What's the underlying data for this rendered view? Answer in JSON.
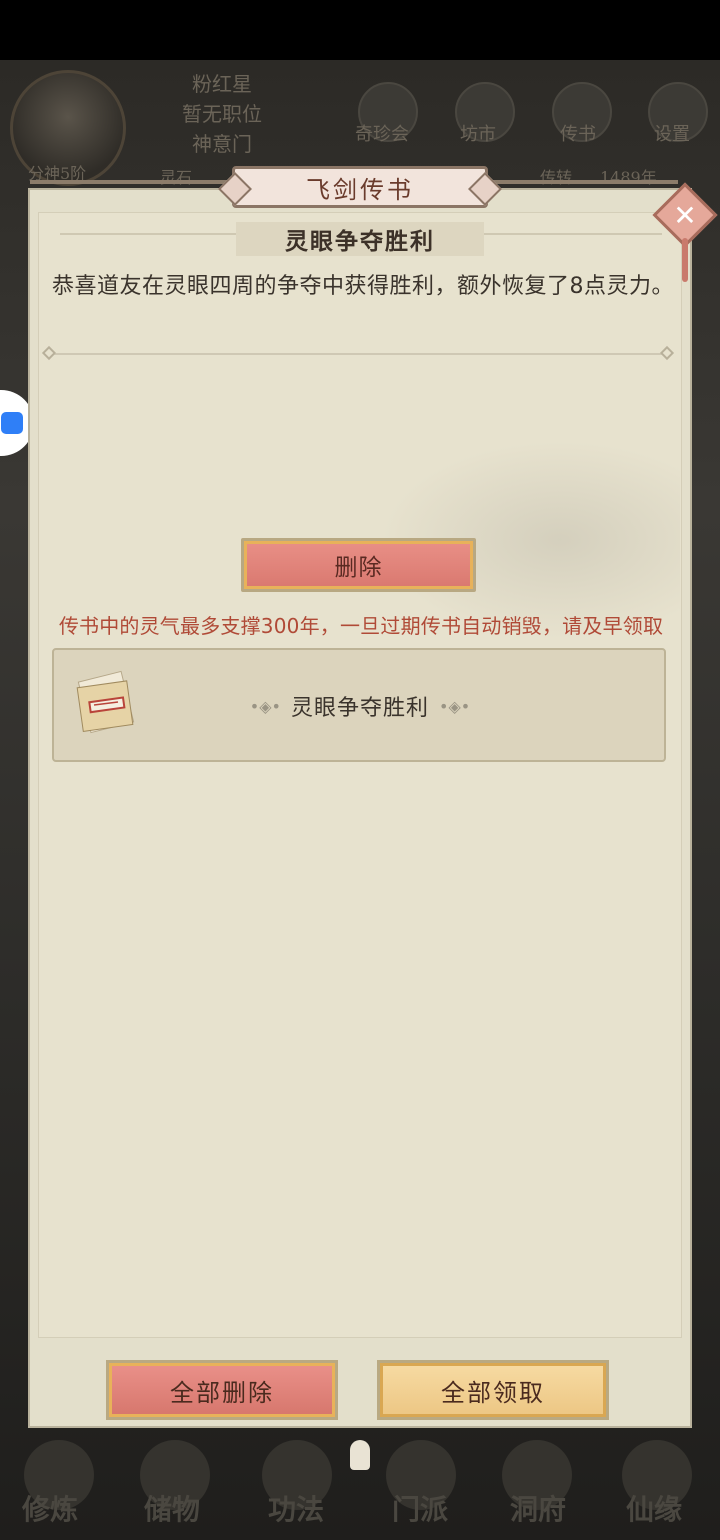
{
  "hud": {
    "rank": "分神5阶",
    "name": "粉红星",
    "position": "暂无职位",
    "sect": "神意门",
    "currency": "灵石",
    "lifespan": "传转",
    "lifespan_value": "1489年",
    "menu": [
      "奇珍会",
      "坊市",
      "传书",
      "设置"
    ]
  },
  "dialog": {
    "title": "飞剑传书",
    "close_icon": "close-icon",
    "subject": "灵眼争夺胜利",
    "message": "恭喜道友在灵眼四周的争夺中获得胜利，额外恢复了8点灵力。",
    "delete_label": "删除",
    "warning": "传书中的灵气最多支撑300年，一旦过期传书自动销毁，请及早领取",
    "mail_items": [
      {
        "title": "灵眼争夺胜利",
        "icon": "letter-icon"
      }
    ],
    "delete_all_label": "全部删除",
    "claim_all_label": "全部领取"
  },
  "bottom_nav": [
    "修炼",
    "储物",
    "功法",
    "门派",
    "洞府",
    "仙缘"
  ],
  "colors": {
    "panel_bg": "#e7e2ce",
    "delete_btn": "#e08178",
    "claim_btn": "#f2d193",
    "warning_text": "#b04a37"
  }
}
